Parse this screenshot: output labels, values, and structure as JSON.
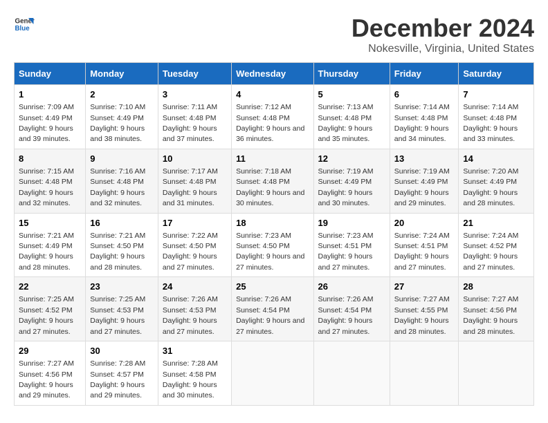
{
  "logo": {
    "text_general": "General",
    "text_blue": "Blue"
  },
  "title": "December 2024",
  "subtitle": "Nokesville, Virginia, United States",
  "days_of_week": [
    "Sunday",
    "Monday",
    "Tuesday",
    "Wednesday",
    "Thursday",
    "Friday",
    "Saturday"
  ],
  "weeks": [
    [
      {
        "day": "1",
        "sunrise": "7:09 AM",
        "sunset": "4:49 PM",
        "daylight": "9 hours and 39 minutes."
      },
      {
        "day": "2",
        "sunrise": "7:10 AM",
        "sunset": "4:49 PM",
        "daylight": "9 hours and 38 minutes."
      },
      {
        "day": "3",
        "sunrise": "7:11 AM",
        "sunset": "4:48 PM",
        "daylight": "9 hours and 37 minutes."
      },
      {
        "day": "4",
        "sunrise": "7:12 AM",
        "sunset": "4:48 PM",
        "daylight": "9 hours and 36 minutes."
      },
      {
        "day": "5",
        "sunrise": "7:13 AM",
        "sunset": "4:48 PM",
        "daylight": "9 hours and 35 minutes."
      },
      {
        "day": "6",
        "sunrise": "7:14 AM",
        "sunset": "4:48 PM",
        "daylight": "9 hours and 34 minutes."
      },
      {
        "day": "7",
        "sunrise": "7:14 AM",
        "sunset": "4:48 PM",
        "daylight": "9 hours and 33 minutes."
      }
    ],
    [
      {
        "day": "8",
        "sunrise": "7:15 AM",
        "sunset": "4:48 PM",
        "daylight": "9 hours and 32 minutes."
      },
      {
        "day": "9",
        "sunrise": "7:16 AM",
        "sunset": "4:48 PM",
        "daylight": "9 hours and 32 minutes."
      },
      {
        "day": "10",
        "sunrise": "7:17 AM",
        "sunset": "4:48 PM",
        "daylight": "9 hours and 31 minutes."
      },
      {
        "day": "11",
        "sunrise": "7:18 AM",
        "sunset": "4:48 PM",
        "daylight": "9 hours and 30 minutes."
      },
      {
        "day": "12",
        "sunrise": "7:19 AM",
        "sunset": "4:49 PM",
        "daylight": "9 hours and 30 minutes."
      },
      {
        "day": "13",
        "sunrise": "7:19 AM",
        "sunset": "4:49 PM",
        "daylight": "9 hours and 29 minutes."
      },
      {
        "day": "14",
        "sunrise": "7:20 AM",
        "sunset": "4:49 PM",
        "daylight": "9 hours and 28 minutes."
      }
    ],
    [
      {
        "day": "15",
        "sunrise": "7:21 AM",
        "sunset": "4:49 PM",
        "daylight": "9 hours and 28 minutes."
      },
      {
        "day": "16",
        "sunrise": "7:21 AM",
        "sunset": "4:50 PM",
        "daylight": "9 hours and 28 minutes."
      },
      {
        "day": "17",
        "sunrise": "7:22 AM",
        "sunset": "4:50 PM",
        "daylight": "9 hours and 27 minutes."
      },
      {
        "day": "18",
        "sunrise": "7:23 AM",
        "sunset": "4:50 PM",
        "daylight": "9 hours and 27 minutes."
      },
      {
        "day": "19",
        "sunrise": "7:23 AM",
        "sunset": "4:51 PM",
        "daylight": "9 hours and 27 minutes."
      },
      {
        "day": "20",
        "sunrise": "7:24 AM",
        "sunset": "4:51 PM",
        "daylight": "9 hours and 27 minutes."
      },
      {
        "day": "21",
        "sunrise": "7:24 AM",
        "sunset": "4:52 PM",
        "daylight": "9 hours and 27 minutes."
      }
    ],
    [
      {
        "day": "22",
        "sunrise": "7:25 AM",
        "sunset": "4:52 PM",
        "daylight": "9 hours and 27 minutes."
      },
      {
        "day": "23",
        "sunrise": "7:25 AM",
        "sunset": "4:53 PM",
        "daylight": "9 hours and 27 minutes."
      },
      {
        "day": "24",
        "sunrise": "7:26 AM",
        "sunset": "4:53 PM",
        "daylight": "9 hours and 27 minutes."
      },
      {
        "day": "25",
        "sunrise": "7:26 AM",
        "sunset": "4:54 PM",
        "daylight": "9 hours and 27 minutes."
      },
      {
        "day": "26",
        "sunrise": "7:26 AM",
        "sunset": "4:54 PM",
        "daylight": "9 hours and 27 minutes."
      },
      {
        "day": "27",
        "sunrise": "7:27 AM",
        "sunset": "4:55 PM",
        "daylight": "9 hours and 28 minutes."
      },
      {
        "day": "28",
        "sunrise": "7:27 AM",
        "sunset": "4:56 PM",
        "daylight": "9 hours and 28 minutes."
      }
    ],
    [
      {
        "day": "29",
        "sunrise": "7:27 AM",
        "sunset": "4:56 PM",
        "daylight": "9 hours and 29 minutes."
      },
      {
        "day": "30",
        "sunrise": "7:28 AM",
        "sunset": "4:57 PM",
        "daylight": "9 hours and 29 minutes."
      },
      {
        "day": "31",
        "sunrise": "7:28 AM",
        "sunset": "4:58 PM",
        "daylight": "9 hours and 30 minutes."
      },
      null,
      null,
      null,
      null
    ]
  ]
}
